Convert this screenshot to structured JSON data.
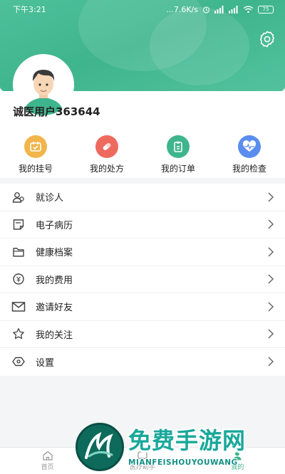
{
  "status_bar": {
    "time": "下午3:21",
    "network_speed": "...7.6K/s",
    "battery": "75"
  },
  "profile": {
    "username": "诚医用户363644"
  },
  "quick_actions": [
    {
      "label": "我的挂号",
      "icon": "registration-icon",
      "color": "#f2b54b"
    },
    {
      "label": "我的处方",
      "icon": "prescription-pill-icon",
      "color": "#ef6a5e"
    },
    {
      "label": "我的订单",
      "icon": "order-clipboard-icon",
      "color": "#3fb58d"
    },
    {
      "label": "我的检查",
      "icon": "heart-pulse-icon",
      "color": "#5b8def"
    }
  ],
  "menu": [
    {
      "label": "就诊人",
      "icon": "patients-icon"
    },
    {
      "label": "电子病历",
      "icon": "medical-record-icon"
    },
    {
      "label": "健康档案",
      "icon": "health-folder-icon"
    },
    {
      "label": "我的费用",
      "icon": "fee-coin-icon"
    },
    {
      "label": "邀请好友",
      "icon": "invite-mail-icon"
    },
    {
      "label": "我的关注",
      "icon": "star-icon"
    },
    {
      "label": "设置",
      "icon": "settings-icon"
    }
  ],
  "bottom_nav": [
    {
      "label": "首页",
      "icon": "home-icon",
      "active": false
    },
    {
      "label": "医疗助手",
      "icon": "assistant-icon",
      "active": false
    },
    {
      "label": "我的",
      "icon": "profile-icon",
      "active": true
    }
  ],
  "watermark": {
    "title": "免费手游网",
    "subtitle": "MIANFEISHOUYOUWANG"
  },
  "colors": {
    "brand": "#3fb58d",
    "watermark_text": "#19a89a"
  }
}
